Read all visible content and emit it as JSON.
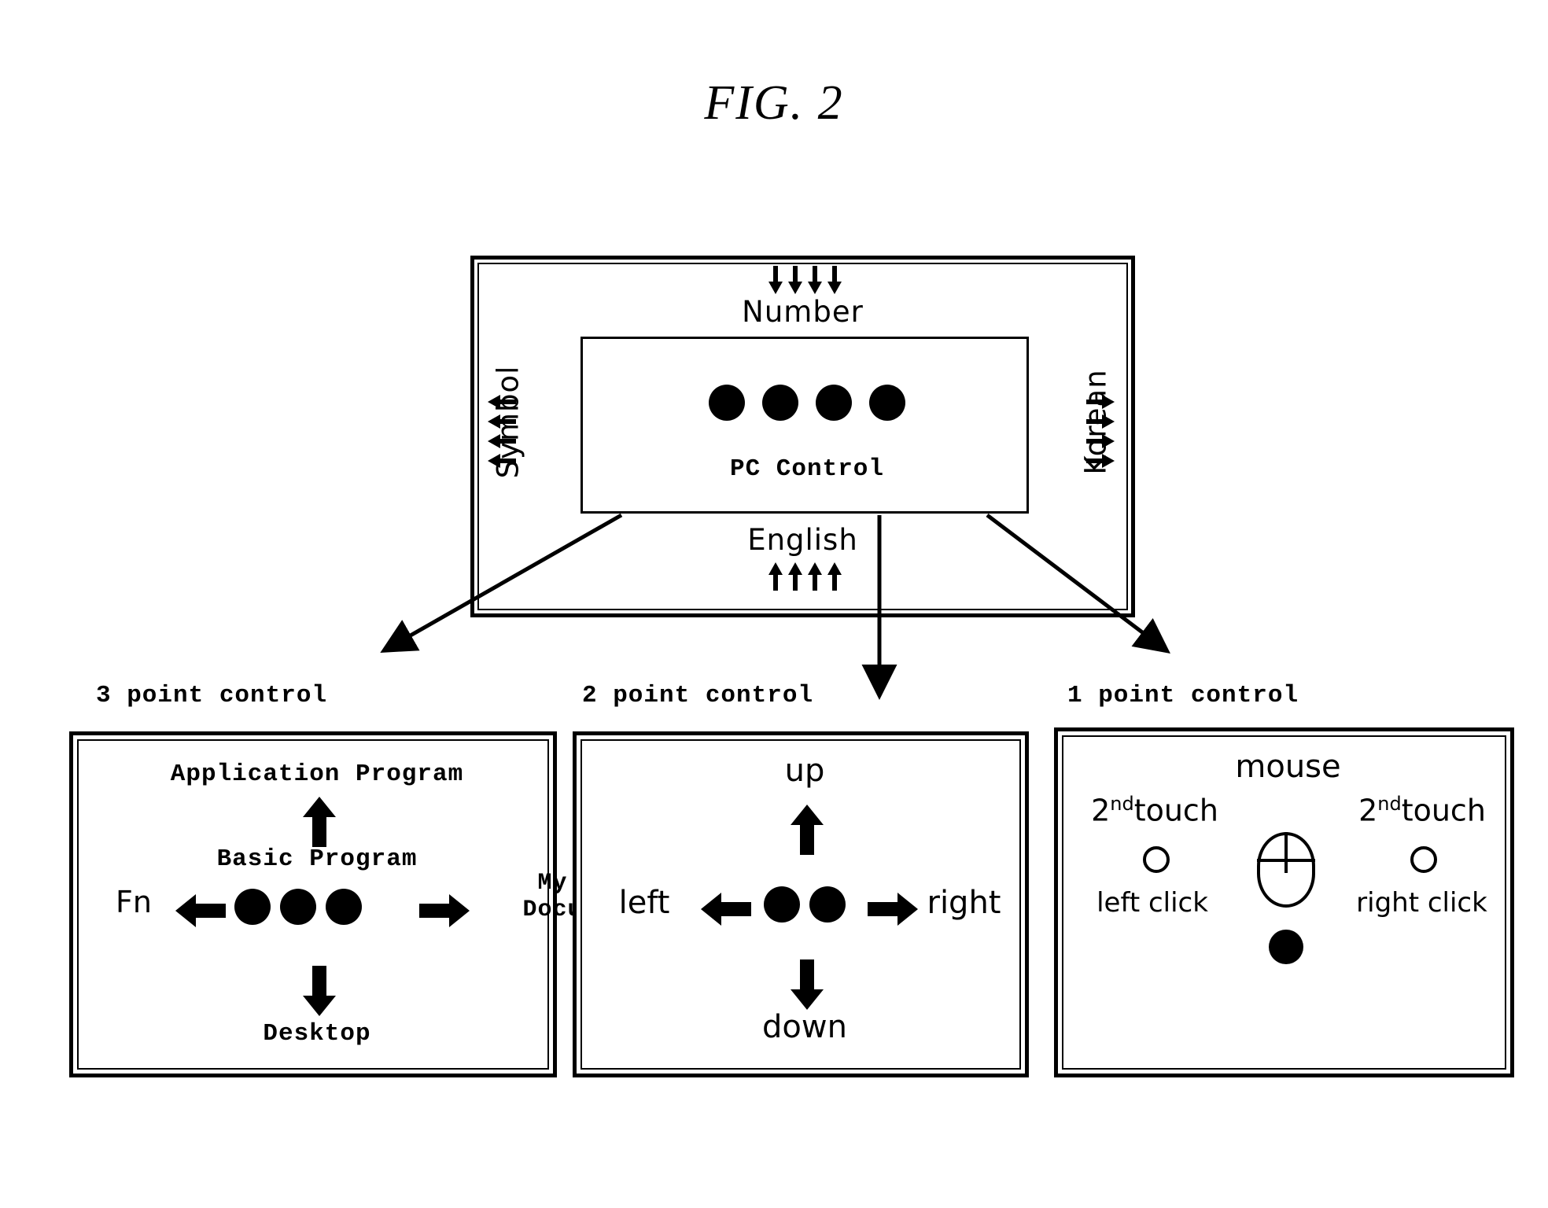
{
  "figure": {
    "title": "FIG. 2"
  },
  "device": {
    "name": "touch input device",
    "center_box": {
      "label": "PC Control",
      "dot_count": 4,
      "dot_icon": "filled-circle-icon"
    },
    "edges": {
      "top": {
        "label": "Number",
        "arrow_icon": "up-arrow-cluster-icon",
        "arrow_direction": "up",
        "arrow_count": 4
      },
      "bottom": {
        "label": "English",
        "arrow_icon": "down-arrow-cluster-icon",
        "arrow_direction": "down",
        "arrow_count": 4
      },
      "left": {
        "label": "Symbol",
        "arrow_icon": "left-arrow-cluster-icon",
        "arrow_direction": "left",
        "arrow_count": 4
      },
      "right": {
        "label": "Korean",
        "arrow_icon": "right-arrow-cluster-icon",
        "arrow_direction": "right",
        "arrow_count": 4
      }
    }
  },
  "sections": {
    "three_point": {
      "caption": "3 point control",
      "dot_count": 3,
      "up_label": "Application Program",
      "center_label": "Basic Program",
      "down_label": "Desktop",
      "left_label": "Fn",
      "right_label_line1": "My",
      "right_label_line2": "Docu"
    },
    "two_point": {
      "caption": "2 point control",
      "dot_count": 2,
      "up_label": "up",
      "down_label": "down",
      "left_label": "left",
      "right_label": "right"
    },
    "one_point": {
      "caption": "1 point control",
      "title": "mouse",
      "second_touch_left_prefix": "2",
      "second_touch_left_sup": "nd",
      "second_touch_left_suffix": "touch",
      "second_touch_right_prefix": "2",
      "second_touch_right_sup": "nd",
      "second_touch_right_suffix": "touch",
      "left_click_label": "left click",
      "right_click_label": "right click",
      "mouse_icon": "computer-mouse-icon",
      "touch_point_icon": "open-circle-icon",
      "contact_point_icon": "filled-circle-icon"
    }
  },
  "colors": {
    "stroke": "#000000",
    "background": "#ffffff"
  }
}
